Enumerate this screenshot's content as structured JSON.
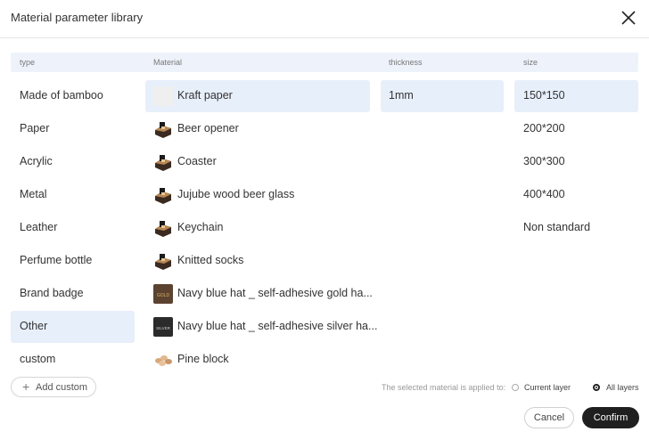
{
  "dialog": {
    "title": "Material parameter library",
    "close_icon": "close-icon"
  },
  "columns": {
    "type": "type",
    "material": "Material",
    "thickness": "thickness",
    "size": "size"
  },
  "types": [
    {
      "label": "Made of bamboo",
      "selected": false
    },
    {
      "label": "Paper",
      "selected": false
    },
    {
      "label": "Acrylic",
      "selected": false
    },
    {
      "label": "Metal",
      "selected": false
    },
    {
      "label": "Leather",
      "selected": false
    },
    {
      "label": "Perfume bottle",
      "selected": false
    },
    {
      "label": "Brand badge",
      "selected": false
    },
    {
      "label": "Other",
      "selected": true
    },
    {
      "label": "custom",
      "selected": false
    }
  ],
  "materials": [
    {
      "label": "Kraft paper",
      "thumb": "blank-thumbnail",
      "selected": true
    },
    {
      "label": "Beer opener",
      "thumb": "product-thumbnail"
    },
    {
      "label": "Coaster",
      "thumb": "product-thumbnail"
    },
    {
      "label": "Jujube wood beer glass",
      "thumb": "product-thumbnail"
    },
    {
      "label": "Keychain",
      "thumb": "product-thumbnail"
    },
    {
      "label": "Knitted socks",
      "thumb": "product-thumbnail"
    },
    {
      "label": "Navy blue hat _ self-adhesive gold ha...",
      "thumb": "gold-badge-thumbnail",
      "thumb_text": "GOLD"
    },
    {
      "label": "Navy blue hat _ self-adhesive silver ha...",
      "thumb": "silver-badge-thumbnail",
      "thumb_text": "SILVER"
    },
    {
      "label": "Pine block",
      "thumb": "pine-block-thumbnail"
    }
  ],
  "thicknesses": [
    {
      "label": "1mm",
      "selected": true
    }
  ],
  "sizes": [
    {
      "label": "150*150",
      "selected": true
    },
    {
      "label": "200*200"
    },
    {
      "label": "300*300"
    },
    {
      "label": "400*400"
    },
    {
      "label": "Non standard"
    }
  ],
  "footer": {
    "add_custom": "Add custom",
    "applied_label": "The selected material is applied to:",
    "options": [
      {
        "label": "Current layer",
        "checked": false
      },
      {
        "label": "All layers",
        "checked": true
      }
    ],
    "cancel": "Cancel",
    "confirm": "Confirm"
  },
  "colors": {
    "selection": "#e7effb",
    "header_bg": "#eef3fb",
    "primary_button": "#1f1f1f"
  }
}
